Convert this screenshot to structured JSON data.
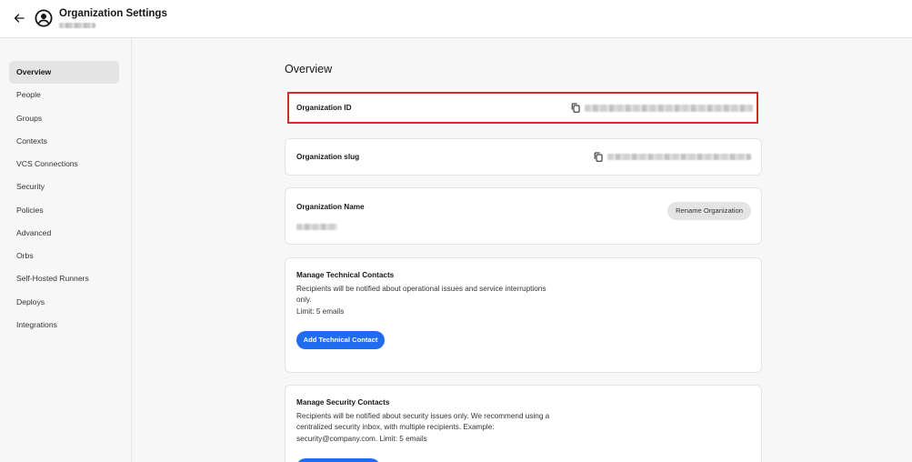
{
  "header": {
    "title": "Organization Settings"
  },
  "sidebar": {
    "items": [
      {
        "label": "Overview",
        "active": true
      },
      {
        "label": "People"
      },
      {
        "label": "Groups"
      },
      {
        "label": "Contexts"
      },
      {
        "label": "VCS Connections"
      },
      {
        "label": "Security"
      },
      {
        "label": "Policies"
      },
      {
        "label": "Advanced"
      },
      {
        "label": "Orbs"
      },
      {
        "label": "Self-Hosted Runners"
      },
      {
        "label": "Deploys"
      },
      {
        "label": "Integrations"
      }
    ]
  },
  "main": {
    "title": "Overview",
    "org_id": {
      "label": "Organization ID"
    },
    "org_slug": {
      "label": "Organization slug"
    },
    "org_name": {
      "label": "Organization Name",
      "rename_label": "Rename Organization"
    },
    "tech_contacts": {
      "title": "Manage Technical Contacts",
      "desc_line1": "Recipients will be notified about operational issues and service interruptions",
      "desc_line2": "only.",
      "limit": "Limit: 5 emails",
      "button": "Add Technical Contact"
    },
    "security_contacts": {
      "title": "Manage Security Contacts",
      "desc_line1": "Recipients will be notified about security issues only. We recommend using a",
      "desc_line2": "centralized security inbox, with multiple recipients. Example:",
      "desc_line3": "security@company.com. Limit: 5 emails"
    }
  },
  "colors": {
    "accent": "#1f6cf0",
    "highlight_border": "#d62b2b"
  },
  "icons": [
    "back-arrow-icon",
    "user-circle-icon",
    "copy-icon"
  ]
}
